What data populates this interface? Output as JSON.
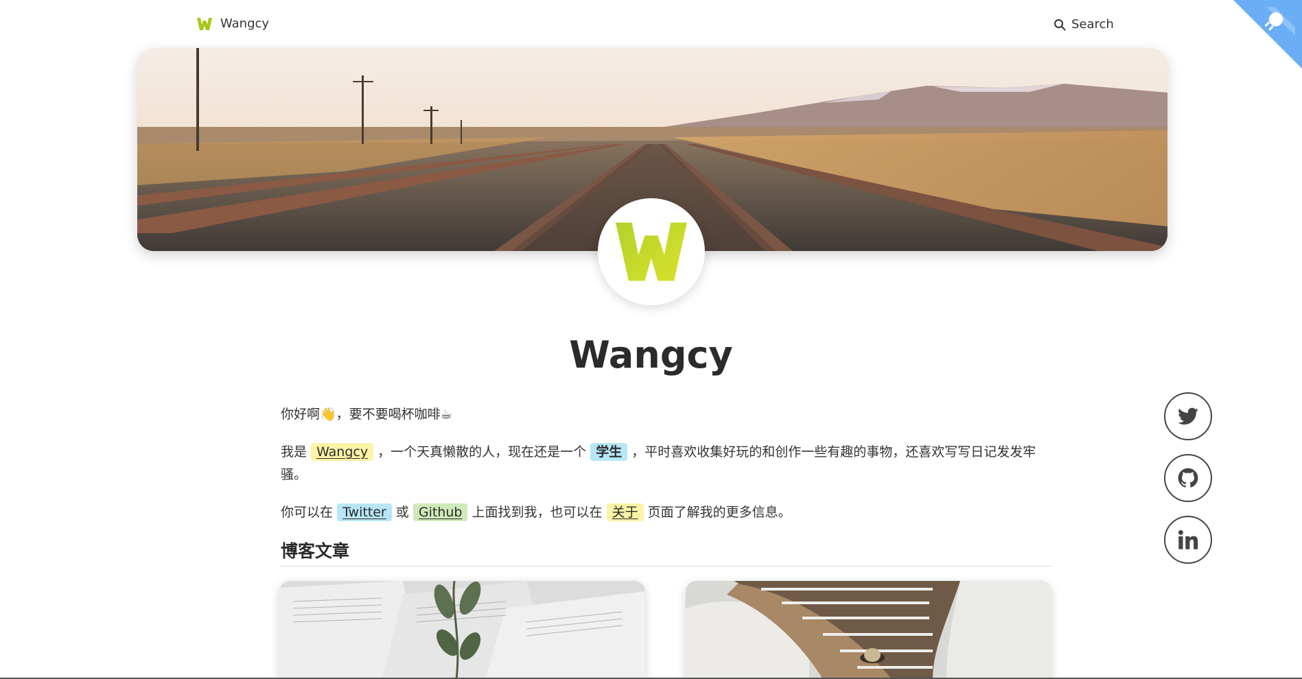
{
  "header": {
    "site_name": "Wangcy",
    "search_label": "Search"
  },
  "profile": {
    "name": "Wangcy"
  },
  "intro": {
    "greeting": "你好啊👋，要不要喝杯咖啡☕",
    "line2": {
      "prefix": "我是",
      "name_link": "Wangcy",
      "mid": "，一个天真懒散的人，现在还是一个",
      "role": "学生",
      "suffix": "，平时喜欢收集好玩的和创作一些有趣的事物，还喜欢写写日记发发牢骚。"
    },
    "line3": {
      "prefix": "你可以在",
      "twitter": "Twitter",
      "or": "或",
      "github": "Github",
      "mid": "上面找到我，也可以在",
      "about": "关于",
      "suffix": "页面了解我的更多信息。"
    }
  },
  "posts": {
    "section_title": "博客文章"
  },
  "social": [
    {
      "icon": "twitter-icon"
    },
    {
      "icon": "github-icon"
    },
    {
      "icon": "linkedin-icon"
    }
  ],
  "colors": {
    "logo_green": "#a6c81a",
    "corner_blue": "#6aaef5",
    "highlight_yellow": "#fbf3a6",
    "highlight_blue": "#b7e6f6",
    "highlight_green": "#cfeab9"
  }
}
